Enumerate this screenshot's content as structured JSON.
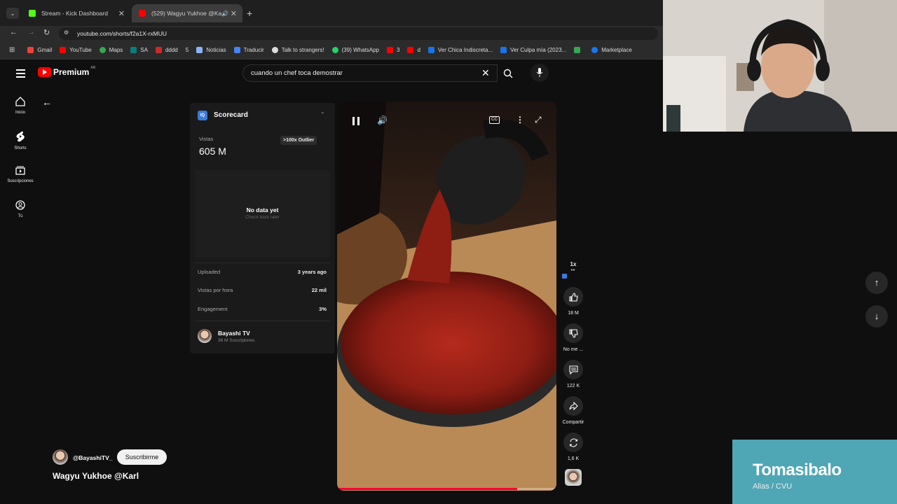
{
  "browser": {
    "tabs": [
      {
        "title": "Stream - Kick Dashboard",
        "color": "#53fc18"
      },
      {
        "title": "(529) Wagyu Yukhoe @Karl",
        "color": "#ff0000"
      }
    ],
    "url": "youtube.com/shorts/f2a1X-rxMUU",
    "bookmarks": [
      {
        "label": "Gmail",
        "color": "#ea4335"
      },
      {
        "label": "YouTube",
        "color": "#ff0000"
      },
      {
        "label": "Maps",
        "color": "#34a853"
      },
      {
        "label": "SA",
        "color": "#0a7d7d"
      },
      {
        "label": "dddd",
        "color": "#cc2b2b"
      },
      {
        "label": "5",
        "color": "#777777"
      },
      {
        "label": "Noticias",
        "color": "#8ab4f8"
      },
      {
        "label": "Traducir",
        "color": "#4285f4"
      },
      {
        "label": "Talk to strangers!",
        "color": "#dddddd"
      },
      {
        "label": "(39) WhatsApp",
        "color": "#25d366"
      },
      {
        "label": "3",
        "color": "#ff0000"
      },
      {
        "label": "d",
        "color": "#ff0000"
      },
      {
        "label": "Ver Chica Indiscreta...",
        "color": "#1a73e8"
      },
      {
        "label": "Ver Culpa mía (2023...",
        "color": "#1a73e8"
      },
      {
        "label": "",
        "color": "#34a853"
      },
      {
        "label": "Marketplace",
        "color": "#1877f2"
      }
    ]
  },
  "youtube": {
    "logo": "Premium",
    "region": "AR",
    "search_value": "cuando un chef toca demostrar",
    "nav": [
      {
        "label": "Inicio",
        "icon": "home-icon"
      },
      {
        "label": "Shorts",
        "icon": "shorts-icon"
      },
      {
        "label": "Suscripciones",
        "icon": "subscriptions-icon"
      },
      {
        "label": "Tú",
        "icon": "you-icon"
      }
    ]
  },
  "scorecard": {
    "title": "Scorecard",
    "views_label": "Vistas",
    "views_value": "605 M",
    "outlier_badge": ">100x Outlier",
    "no_data": "No data yet",
    "check_back": "Check back later",
    "uploaded_label": "Uploaded",
    "uploaded_value": "3 years ago",
    "vph_label": "Vistas por hora",
    "vph_value": "22 mil",
    "engagement_label": "Engagement",
    "engagement_value": "3%",
    "channel_name": "Bayashi TV",
    "channel_subs": "36 M Suscriptores"
  },
  "video": {
    "channel_handle": "@BayashiTV_",
    "subscribe_label": "Suscribirme",
    "title": "Wagyu Yukhoe @Karl",
    "progress": 0.82
  },
  "actions": {
    "speed": "1x",
    "likes": "18 M",
    "dislike": "No me ...",
    "comments": "122 K",
    "share": "Compartir",
    "remix": "1,6 K"
  },
  "overlay": {
    "name": "Tomasibalo",
    "sub": "Alias / CVU"
  }
}
